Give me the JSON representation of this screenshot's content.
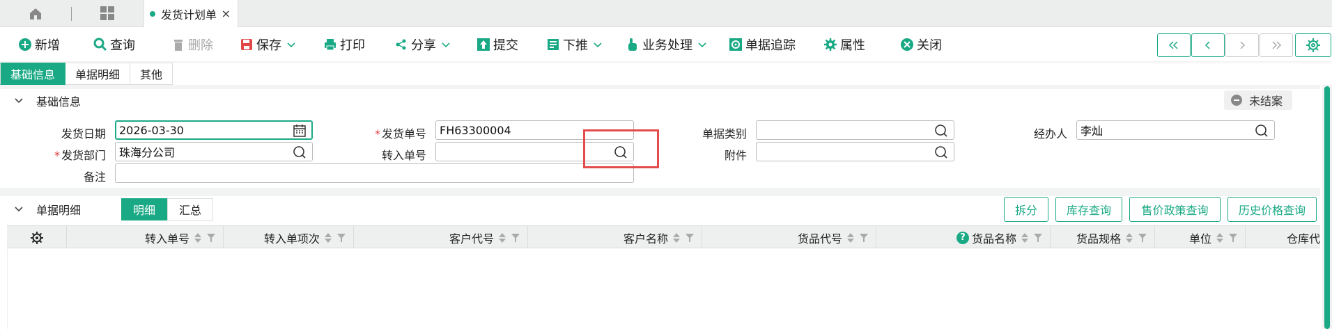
{
  "tabbar": {
    "doc_tab_title": "发货计划单",
    "close_glyph": "×"
  },
  "toolbar": {
    "new": "新增",
    "query": "查询",
    "delete": "删除",
    "save": "保存",
    "print": "打印",
    "share": "分享",
    "submit": "提交",
    "push_down": "下推",
    "business": "业务处理",
    "trace": "单据追踪",
    "properties": "属性",
    "close": "关闭"
  },
  "section_tabs": [
    "基础信息",
    "单据明细",
    "其他"
  ],
  "base_info": {
    "title": "基础信息",
    "status": "未结案",
    "labels": {
      "ship_date": "发货日期",
      "ship_no": "发货单号",
      "doc_type": "单据类别",
      "handler": "经办人",
      "ship_dept": "发货部门",
      "transfer_no": "转入单号",
      "attachment": "附件",
      "remark": "备注"
    },
    "required_mark": "*",
    "values": {
      "ship_date": "2026-03-30",
      "ship_no": "FH63300004",
      "doc_type": "",
      "handler": "李灿",
      "ship_dept": "珠海分公司",
      "transfer_no": "",
      "attachment": "",
      "remark": ""
    }
  },
  "detail": {
    "title": "单据明细",
    "subtabs": [
      "明细",
      "汇总"
    ],
    "actions": [
      "拆分",
      "库存查询",
      "售价政策查询",
      "历史价格查询"
    ],
    "columns": [
      "转入单号",
      "转入单项次",
      "客户代号",
      "客户名称",
      "货品代号",
      "货品名称",
      "货品规格",
      "单位",
      "仓库代"
    ]
  },
  "colors": {
    "accent": "#1aa985",
    "required": "#e03c3c",
    "highlight": "#e54b4b"
  }
}
